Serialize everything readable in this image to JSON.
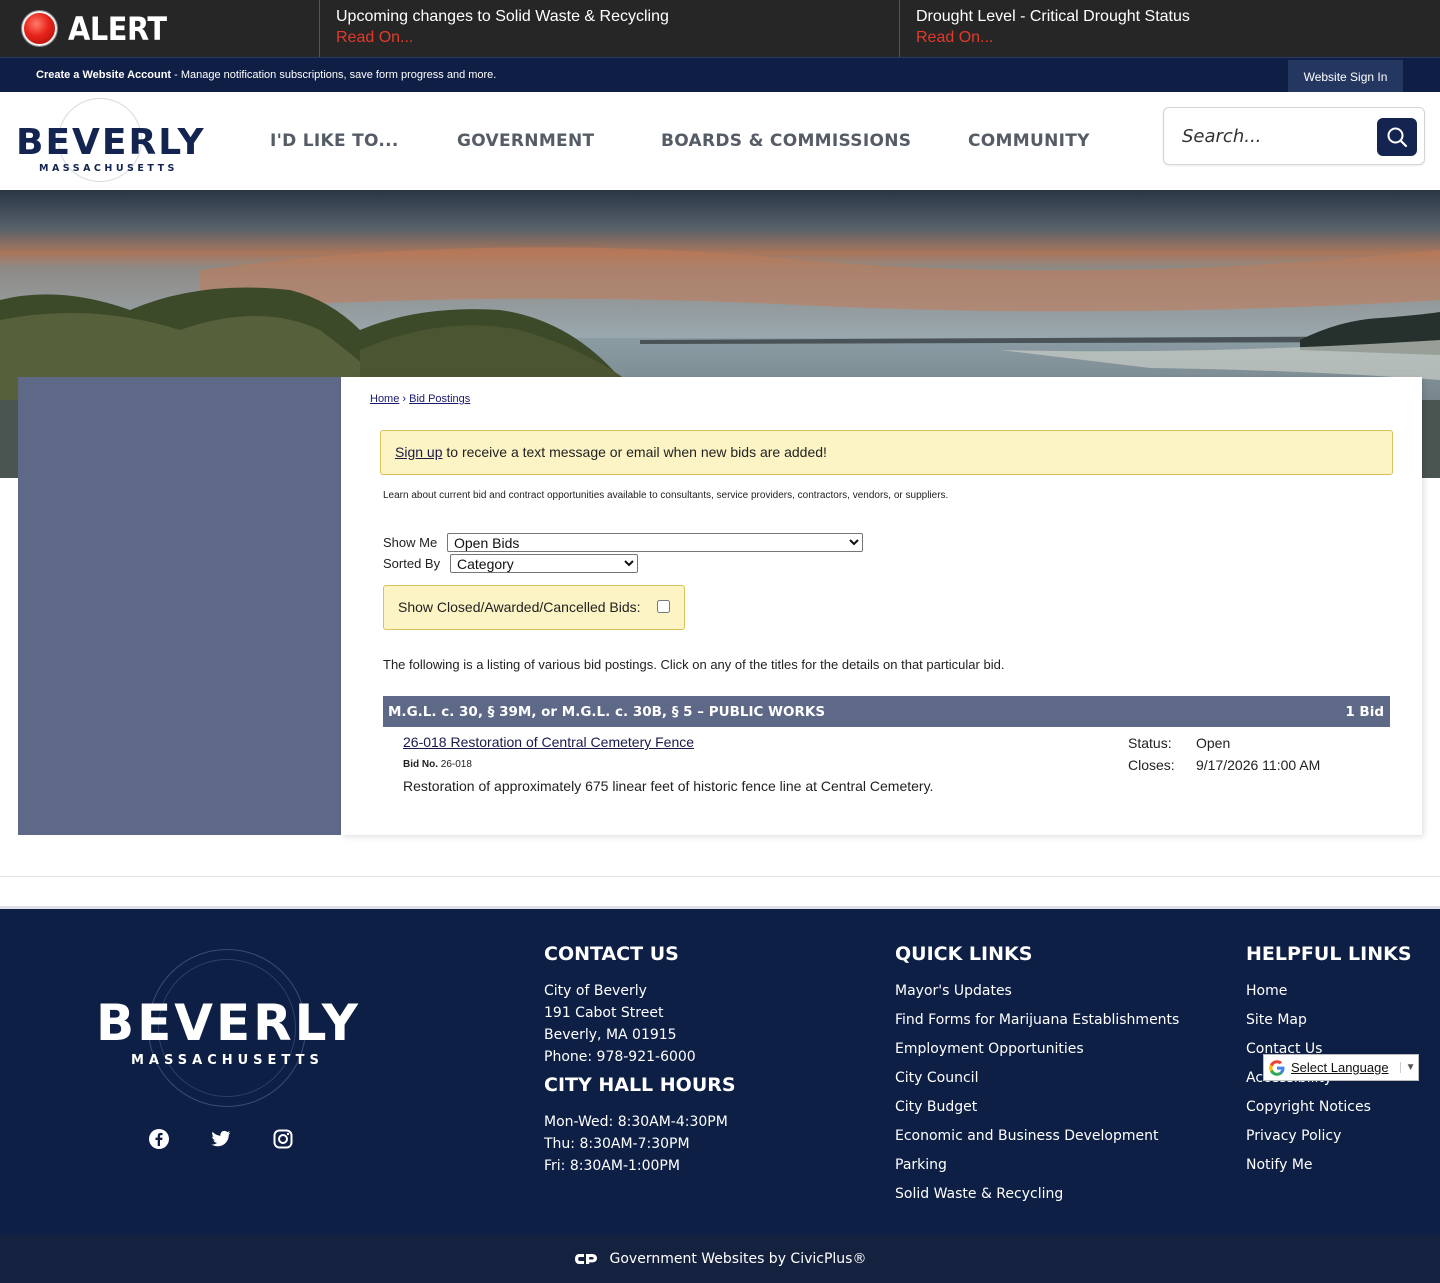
{
  "alert": {
    "label": "ALERT",
    "items": [
      {
        "title": "Upcoming changes to Solid Waste & Recycling",
        "link": "Read On..."
      },
      {
        "title": "Drought Level - Critical Drought Status",
        "link": "Read On..."
      }
    ]
  },
  "account_bar": {
    "create_label": "Create a Website Account",
    "description": " - Manage notification subscriptions, save form progress and more.",
    "sign_in": "Website Sign In"
  },
  "header": {
    "logo_word": "BEVERLY",
    "logo_sub": "MASSACHUSETTS",
    "nav": [
      "I'D LIKE TO...",
      "GOVERNMENT",
      "BOARDS & COMMISSIONS",
      "COMMUNITY"
    ],
    "search_placeholder": "Search..."
  },
  "breadcrumb": {
    "home": "Home",
    "separator": "›",
    "current": "Bid Postings"
  },
  "notice": {
    "link": "Sign up",
    "text": " to receive a text message or email when new bids are added!"
  },
  "intro": "Learn about current bid and contract opportunities available to consultants, service providers, contractors, vendors, or suppliers.",
  "filters": {
    "show_me_label": "Show Me",
    "show_me_value": "Open Bids",
    "sorted_by_label": "Sorted By",
    "sorted_by_value": "Category",
    "closed_label": "Show Closed/Awarded/Cancelled Bids:"
  },
  "listing_text": "The following is a listing of various bid postings. Click on any of the titles for the details on that particular bid.",
  "category": {
    "title": "M.G.L. c. 30, § 39M, or M.G.L. c. 30B, § 5 – PUBLIC WORKS",
    "count": "1 Bid",
    "bids": [
      {
        "title": "26-018 Restoration of Central Cemetery Fence",
        "bid_no_label": "Bid No.",
        "bid_no": "26-018",
        "description": "Restoration of approximately 675 linear feet of historic fence line at Central Cemetery.",
        "status_label": "Status:",
        "status": "Open",
        "closes_label": "Closes:",
        "closes": "9/17/2026 11:00 AM"
      }
    ]
  },
  "footer": {
    "logo_word": "BEVERLY",
    "logo_sub": "MASSACHUSETTS",
    "social": [
      "facebook-icon",
      "twitter-icon",
      "instagram-icon"
    ],
    "contact_heading": "CONTACT US",
    "contact_lines": [
      "City of Beverly",
      "191 Cabot Street",
      "Beverly, MA 01915",
      "Phone: 978-921-6000"
    ],
    "hours_heading": "CITY HALL HOURS",
    "hours_lines": [
      "Mon-Wed: 8:30AM-4:30PM",
      "Thu: 8:30AM-7:30PM",
      "Fri: 8:30AM-1:00PM"
    ],
    "quick_heading": "QUICK LINKS",
    "quick_links": [
      "Mayor's Updates",
      "Find Forms for Marijuana Establishments",
      "Employment Opportunities",
      "City Council",
      "City Budget",
      "Economic and Business Development",
      "Parking",
      "Solid Waste & Recycling"
    ],
    "helpful_heading": "HELPFUL LINKS",
    "helpful_links": [
      "Home",
      "Site Map",
      "Contact Us",
      "Accessibility",
      "Copyright Notices",
      "Privacy Policy",
      "Notify Me"
    ],
    "language": "Select Language",
    "language_arrow": "▼"
  },
  "bottom_bar": "Government Websites by CivicPlus®"
}
